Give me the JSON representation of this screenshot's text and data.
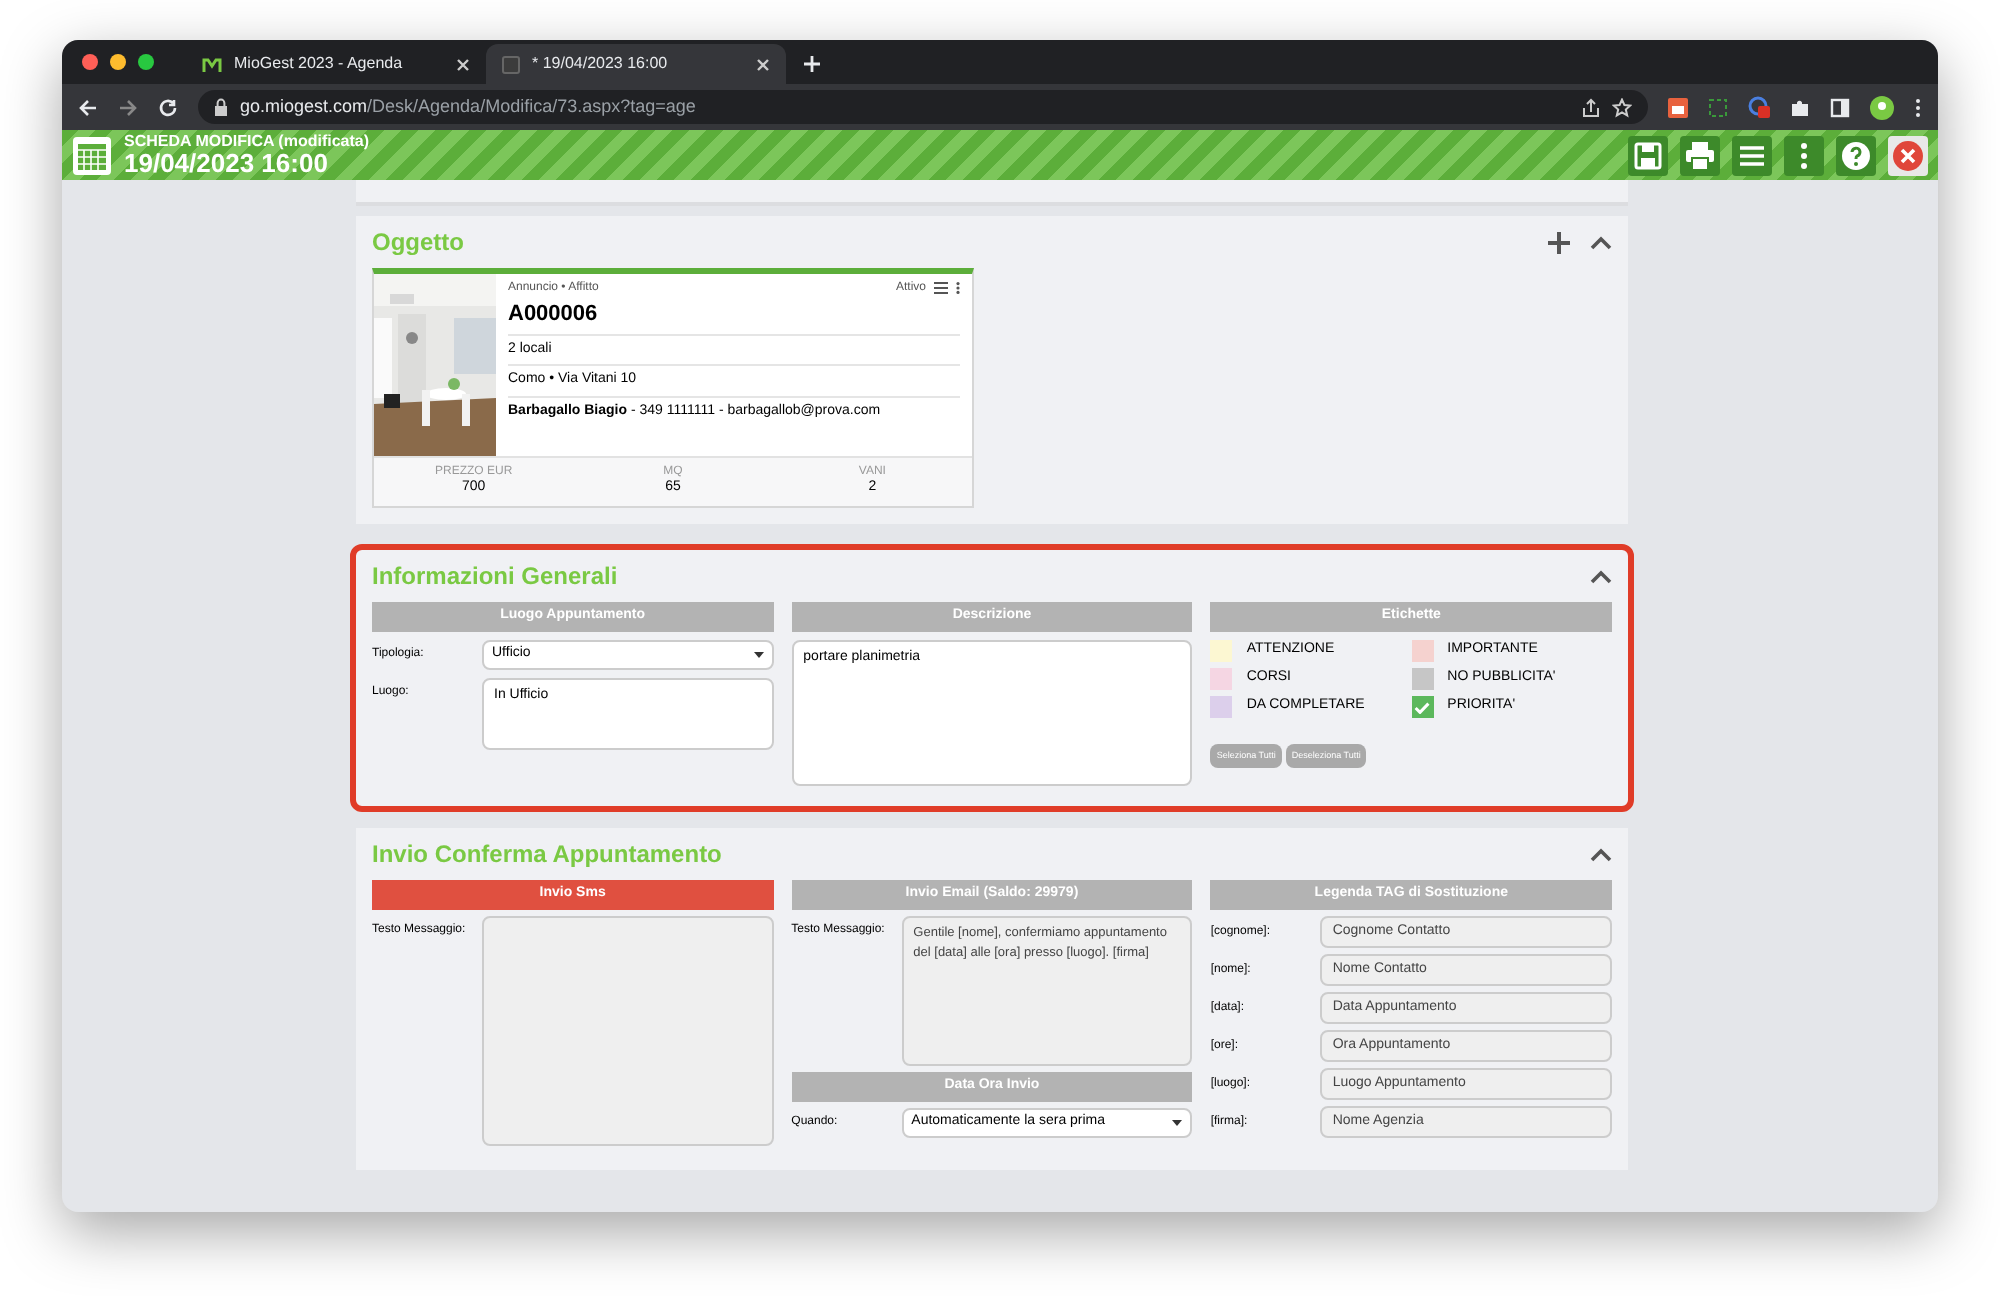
{
  "browser": {
    "tabs": [
      {
        "title": "MioGest 2023 - Agenda",
        "selected": false
      },
      {
        "title": "* 19/04/2023 16:00",
        "selected": true
      }
    ],
    "url_host": "go.miogest.com",
    "url_path": "/Desk/Agenda/Modifica/73.aspx?tag=age"
  },
  "header": {
    "subtitle": "SCHEDA MODIFICA (modificata)",
    "title": "19/04/2023 16:00",
    "tools": [
      {
        "kind": "save"
      },
      {
        "kind": "print"
      },
      {
        "kind": "menu"
      },
      {
        "kind": "more"
      },
      {
        "kind": "help"
      },
      {
        "kind": "close"
      }
    ]
  },
  "oggetto": {
    "title": "Oggetto",
    "card": {
      "category": "Annuncio • Affitto",
      "status": "Attivo",
      "code": "A000006",
      "rooms": "2 locali",
      "address": "Como • Via Vitani 10",
      "contact": "**Barbagallo Biagio** - 349 1111111 - barbagallob@prova.com",
      "stats": [
        {
          "label": "PREZZO EUR",
          "value": "700"
        },
        {
          "label": "MQ",
          "value": "65"
        },
        {
          "label": "VANI",
          "value": "2"
        }
      ]
    }
  },
  "informazioni": {
    "title": "Informazioni Generali",
    "highlighted": true,
    "luogo": {
      "heading": "Luogo Appuntamento",
      "tipologia_label": "Tipologia:",
      "tipologia_value": "Ufficio",
      "luogo_label": "Luogo:",
      "luogo_value": "In Ufficio"
    },
    "descrizione": {
      "heading": "Descrizione",
      "value": "portare planimetria"
    },
    "etichette": {
      "heading": "Etichette",
      "tags": [
        {
          "label": "ATTENZIONE",
          "color": "#fcf7d2",
          "checked": false
        },
        {
          "label": "IMPORTANTE",
          "color": "#f5d2cf",
          "checked": false
        },
        {
          "label": "CORSI",
          "color": "#f5d6e3",
          "checked": false
        },
        {
          "label": "NO PUBBLICITA'",
          "color": "#c6c6c6",
          "checked": false
        },
        {
          "label": "DA COMPLETARE",
          "color": "#dccfeb",
          "checked": false
        },
        {
          "label": "PRIORITA'",
          "color": "#5cb85c",
          "checked": true
        }
      ],
      "buttons": [
        "Seleziona Tutti",
        "Deseleziona Tutti"
      ]
    }
  },
  "invio": {
    "title": "Invio Conferma Appuntamento",
    "sms": {
      "heading": "Invio Sms",
      "selected": true,
      "label": "Testo Messaggio:"
    },
    "email": {
      "heading": "Invio Email (Saldo: 29979)",
      "selected": false,
      "label": "Testo Messaggio:",
      "value": "Gentile [nome], confermiamo appuntamento del [data] alle [ora] presso [luogo]. [firma]"
    },
    "data_ora": {
      "heading": "Data Ora Invio",
      "label": "Quando:",
      "value": "Automaticamente la sera prima"
    },
    "legenda": {
      "heading": "Legenda TAG di Sostituzione",
      "rows": [
        {
          "tag": "[cognome]:",
          "value": "Cognome Contatto"
        },
        {
          "tag": "[nome]:",
          "value": "Nome Contatto"
        },
        {
          "tag": "[data]:",
          "value": "Data Appuntamento"
        },
        {
          "tag": "[ore]:",
          "value": "Ora Appuntamento"
        },
        {
          "tag": "[luogo]:",
          "value": "Luogo Appuntamento"
        },
        {
          "tag": "[firma]:",
          "value": "Nome Agenzia"
        }
      ]
    }
  }
}
